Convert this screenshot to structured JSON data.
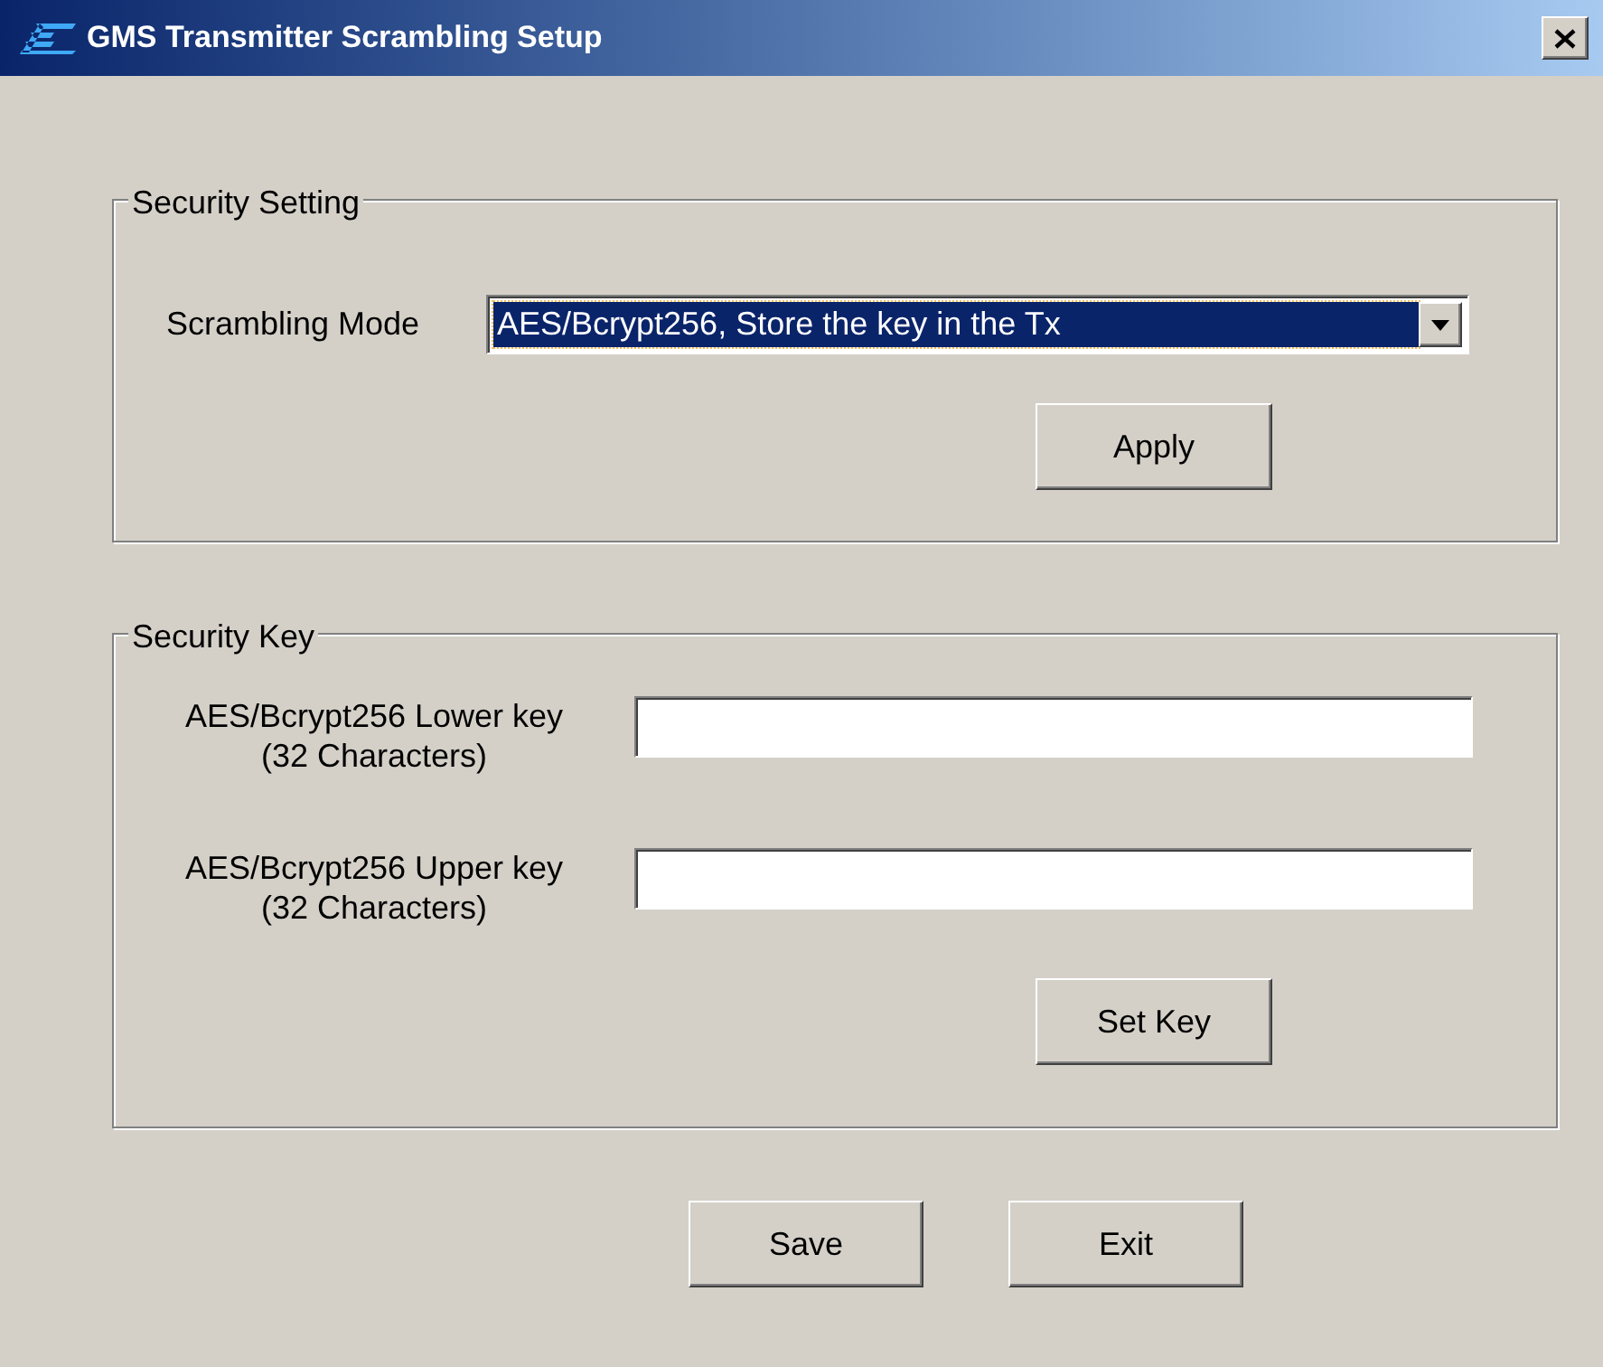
{
  "window": {
    "title": "GMS Transmitter Scrambling Setup"
  },
  "security_setting": {
    "title": "Security Setting",
    "scrambling_mode": {
      "label": "Scrambling Mode",
      "value": "AES/Bcrypt256, Store the key in the Tx",
      "focused": true
    },
    "apply_button": "Apply"
  },
  "security_key": {
    "title": "Security Key",
    "fields": [
      {
        "label": "AES/Bcrypt256 Lower key",
        "hint": "(32 Characters)"
      },
      {
        "label": "AES/Bcrypt256 Upper key",
        "hint": "(32 Characters)"
      }
    ],
    "set_key_button": "Set Key"
  },
  "buttons": [
    "Save",
    "Exit"
  ]
}
